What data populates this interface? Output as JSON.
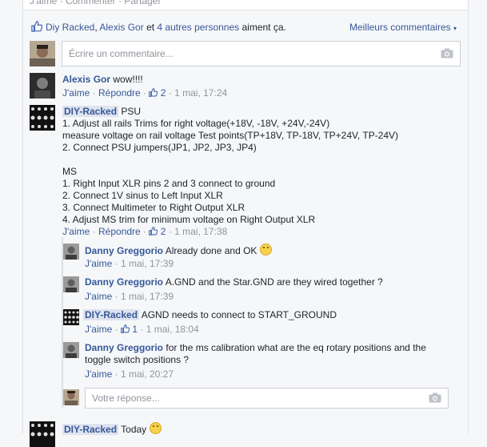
{
  "top_bar": {
    "text": "J'aime · Commenter · Partager"
  },
  "likes": {
    "names": [
      "Diy Racked",
      "Alexis Gor"
    ],
    "others": "4 autres personnes",
    "suffix": "aiment ça.",
    "sort_label": "Meilleurs commentaires"
  },
  "comment_input": {
    "placeholder": "Écrire un commentaire..."
  },
  "comments": [
    {
      "author": "Alexis Gor",
      "text": "wow!!!!",
      "like": "J'aime",
      "reply": "Répondre",
      "likes": "2",
      "time": "1 mai, 17:24"
    },
    {
      "author": "DIY-Racked",
      "lines": [
        "PSU",
        "1. Adjust all rails Trims for right voltage(+18V, -18V, +24V,-24V)",
        "measure voltage on rail voltage Test points(TP+18V, TP-18V, TP+24V, TP-24V)",
        "2. Connect PSU jumpers(JP1, JP2, JP3, JP4)",
        "",
        "MS",
        "1. Right Input XLR pins 2 and 3 connect to ground",
        "2. Connect 1V sinus to Left Input XLR",
        "3. Connect Multimeter to Right Output XLR",
        "4. Adjust MS trim for minimum voltage on Right Output XLR"
      ],
      "like": "J'aime",
      "reply": "Répondre",
      "likes": "2",
      "time": "1 mai, 17:38"
    }
  ],
  "replies": [
    {
      "author": "Danny Greggorio",
      "text": "Already done and OK",
      "like": "J'aime",
      "time": "1 mai, 17:39"
    },
    {
      "author": "Danny Greggorio",
      "text": "A.GND and the Star.GND are they wired together ?",
      "like": "J'aime",
      "time": "1 mai, 17:39"
    },
    {
      "author": "DIY-Racked",
      "text": "AGND needs to connect to START_GROUND",
      "like": "J'aime",
      "likes": "1",
      "time": "1 mai, 18:04"
    },
    {
      "author": "Danny Greggorio",
      "text_line1": "for the ms calibration what are the eq rotary positions and the",
      "text_line2": "toggle switch positions ?",
      "like": "J'aime",
      "time": "1 mai, 20:27"
    }
  ],
  "reply_input": {
    "placeholder": "Votre réponse..."
  },
  "last_comment": {
    "author": "DIY-Racked",
    "text": "Today"
  }
}
